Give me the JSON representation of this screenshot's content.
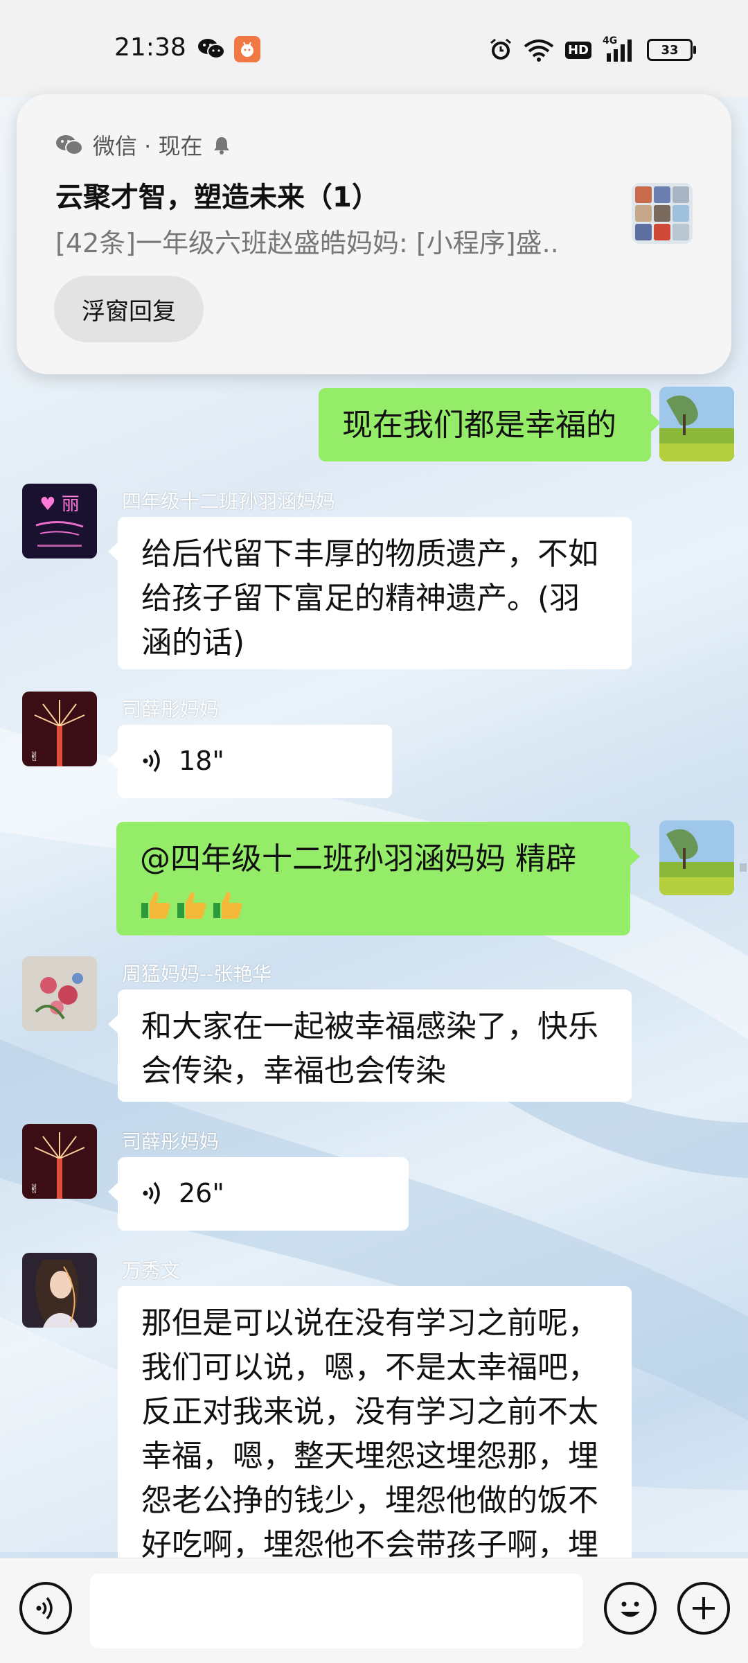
{
  "status_bar": {
    "time": "21:38",
    "battery": "33",
    "network": "4G",
    "hd_label": "HD"
  },
  "notification": {
    "app_name": "微信 · 现在",
    "title": "云聚才智，塑造未来（1）",
    "text": "[42条]一年级六班赵盛皓妈妈: [小程序]盛..",
    "reply_button": "浮窗回复"
  },
  "messages": [
    {
      "direction": "out",
      "text": "现在我们都是幸福的"
    },
    {
      "direction": "in",
      "sender": "四年级十二班孙羽涵妈妈",
      "text": "给后代留下丰厚的物质遗产，不如给孩子留下富足的精神遗产。(羽涵的话)"
    },
    {
      "direction": "in",
      "sender": "司薛彤妈妈",
      "voice_duration": "18\""
    },
    {
      "direction": "out",
      "text": "@四年级十二班孙羽涵妈妈  精辟"
    },
    {
      "direction": "in",
      "sender": "周猛妈妈--张艳华",
      "text": "和大家在一起被幸福感染了，快乐会传染，幸福也会传染"
    },
    {
      "direction": "in",
      "sender": "司薛彤妈妈",
      "voice_duration": "26\""
    },
    {
      "direction": "in",
      "sender": "万秀文",
      "text": "那但是可以说在没有学习之前呢，我们可以说，嗯，不是太幸福吧，反正对我来说，没有学习之前不太幸福，嗯，整天埋怨这埋怨那，埋怨老公挣的钱少，埋怨他做的饭不好吃啊，埋怨他不会带孩子啊，埋怨我们的孩子学习不主动，学习不"
    }
  ],
  "icons": {
    "voice_input": "voice-icon",
    "emoji": "emoji-icon",
    "more": "plus-icon"
  },
  "colors": {
    "out_bubble": "#95ec69",
    "in_bubble": "#ffffff"
  }
}
